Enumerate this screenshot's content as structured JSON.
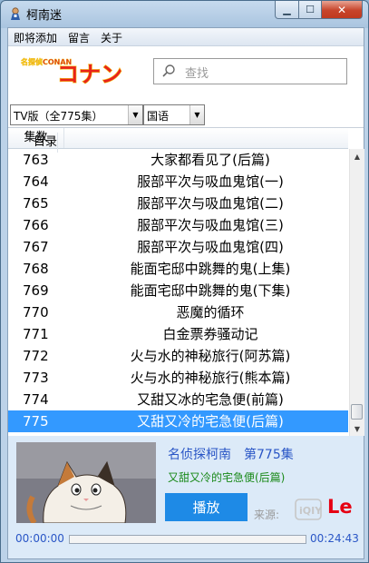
{
  "window": {
    "title": "柯南迷"
  },
  "menu": [
    "即将添加",
    "留言",
    "关于"
  ],
  "logo": {
    "small_text": "名探偵CONAN",
    "main_text": "コナン"
  },
  "search": {
    "placeholder": "查找"
  },
  "version_select": {
    "value": "TV版（全775集）"
  },
  "language_select": {
    "value": "国语"
  },
  "table": {
    "headers": [
      "集数",
      "目录"
    ],
    "rows": [
      {
        "num": "763",
        "title": "大家都看见了(后篇)"
      },
      {
        "num": "764",
        "title": "服部平次与吸血鬼馆(一)"
      },
      {
        "num": "765",
        "title": "服部平次与吸血鬼馆(二)"
      },
      {
        "num": "766",
        "title": "服部平次与吸血鬼馆(三)"
      },
      {
        "num": "767",
        "title": "服部平次与吸血鬼馆(四)"
      },
      {
        "num": "768",
        "title": "能面宅邸中跳舞的鬼(上集)"
      },
      {
        "num": "769",
        "title": "能面宅邸中跳舞的鬼(下集)"
      },
      {
        "num": "770",
        "title": "恶魔的循环"
      },
      {
        "num": "771",
        "title": "白金票券骚动记"
      },
      {
        "num": "772",
        "title": "火与水的神秘旅行(阿苏篇)"
      },
      {
        "num": "773",
        "title": "火与水的神秘旅行(熊本篇)"
      },
      {
        "num": "774",
        "title": "又甜又冰的宅急便(前篇)"
      },
      {
        "num": "775",
        "title": "又甜又冷的宅急便(后篇)"
      }
    ],
    "selected_num": "775"
  },
  "player": {
    "series_title": "名侦探柯南　第775集",
    "episode_title": "又甜又冷的宅急便(后篇)",
    "play_label": "播放",
    "source_label": "来源:",
    "time_start": "00:00:00",
    "time_end": "00:24:43",
    "progress": 0
  },
  "colors": {
    "selection": "#3399ff",
    "accent_blue": "#1e8ae6",
    "link_blue": "#2a56c6",
    "green": "#1b8a1b",
    "le_red": "#e60012"
  }
}
